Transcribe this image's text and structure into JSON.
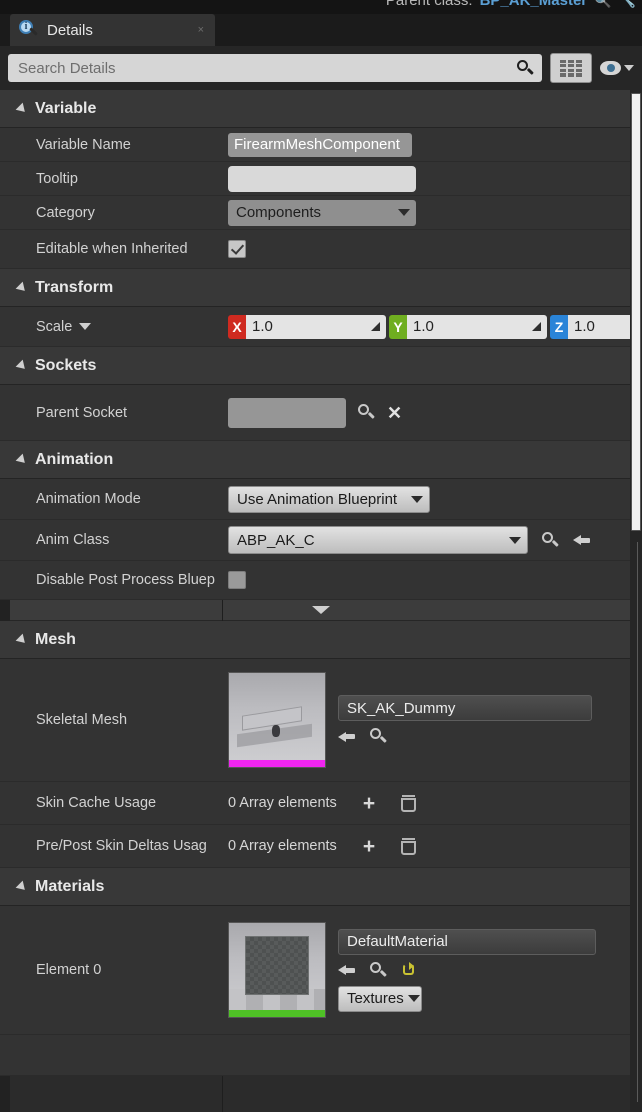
{
  "topbar": {
    "parent_class_label": "Parent class:",
    "parent_class_value": "BP_AK_Master",
    "search_icon": "magnifier-icon",
    "edit_icon": "wrench-icon"
  },
  "tab": {
    "title": "Details",
    "icon": "details-magnifier-info-icon",
    "close_label": "×"
  },
  "search": {
    "placeholder": "Search Details",
    "value": "",
    "icon": "search-icon",
    "grid_button": "column-settings-icon",
    "eye_button": "visibility-eye-icon",
    "eye_caret": "chevron-down-icon"
  },
  "sections": {
    "variable": {
      "title": "Variable",
      "rows": {
        "variable_name": {
          "label": "Variable Name",
          "value": "FirearmMeshComponent"
        },
        "tooltip": {
          "label": "Tooltip",
          "value": ""
        },
        "category": {
          "label": "Category",
          "value": "Components"
        },
        "editable_when_inherited": {
          "label": "Editable when Inherited",
          "checked": true
        }
      }
    },
    "transform": {
      "title": "Transform",
      "scale": {
        "label": "Scale",
        "axes": [
          {
            "tag": "X",
            "value": "1.0",
            "color": "#cf2a20"
          },
          {
            "tag": "Y",
            "value": "1.0",
            "color": "#6fae20"
          },
          {
            "tag": "Z",
            "value": "1.0",
            "color": "#2a84d8"
          }
        ],
        "lock_icon": "unlocked-padlock-icon"
      }
    },
    "sockets": {
      "title": "Sockets",
      "parent_socket": {
        "label": "Parent Socket",
        "value": "",
        "browse_icon": "magnifier-icon",
        "clear_icon": "close-x-icon"
      }
    },
    "animation": {
      "title": "Animation",
      "animation_mode": {
        "label": "Animation Mode",
        "value": "Use Animation Blueprint"
      },
      "anim_class": {
        "label": "Anim Class",
        "value": "ABP_AK_C",
        "browse_icon": "magnifier-icon",
        "use_selected_icon": "arrow-left-icon"
      },
      "disable_post_process": {
        "label": "Disable Post Process Bluep",
        "checked": false
      },
      "expand_icon": "chevron-down-icon"
    },
    "mesh": {
      "title": "Mesh",
      "skeletal_mesh": {
        "label": "Skeletal Mesh",
        "value": "SK_AK_Dummy",
        "thumbnail": "skeletal-mesh-thumbnail",
        "strip_color": "#ef25ef",
        "use_selected_icon": "arrow-left-icon",
        "browse_icon": "magnifier-icon"
      },
      "skin_cache_usage": {
        "label": "Skin Cache Usage",
        "value": "0 Array elements",
        "add_icon": "plus-icon",
        "delete_icon": "trash-icon"
      },
      "pre_post_skin_deltas": {
        "label": "Pre/Post Skin Deltas Usag",
        "value": "0 Array elements",
        "add_icon": "plus-icon",
        "delete_icon": "trash-icon"
      }
    },
    "materials": {
      "title": "Materials",
      "element_0": {
        "label": "Element 0",
        "value": "DefaultMaterial",
        "thumbnail": "material-thumbnail",
        "strip_color": "#4fc126",
        "use_selected_icon": "arrow-left-icon",
        "browse_icon": "magnifier-icon",
        "reset_icon": "reset-arrow-icon",
        "textures_button": "Textures"
      }
    }
  }
}
